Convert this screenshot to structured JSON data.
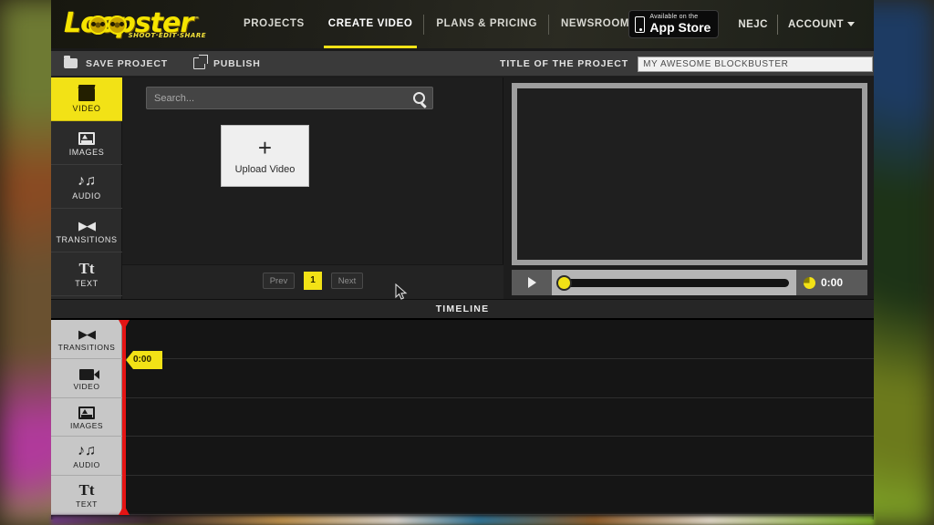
{
  "header": {
    "logo_text": "Loopster",
    "logo_tm": "™",
    "logo_tagline": "SHOOT·EDIT·SHARE",
    "nav": [
      {
        "label": "PROJECTS",
        "active": false
      },
      {
        "label": "CREATE VIDEO",
        "active": true
      },
      {
        "label": "PLANS & PRICING",
        "active": false
      },
      {
        "label": "NEWSROOM",
        "active": false
      }
    ],
    "appstore": {
      "small": "Available on the",
      "big": "App Store"
    },
    "user": "NEJC",
    "account": "ACCOUNT"
  },
  "toolbar": {
    "save_label": "SAVE PROJECT",
    "publish_label": "PUBLISH",
    "title_label": "TITLE OF THE PROJECT",
    "title_value": "MY AWESOME BLOCKBUSTER"
  },
  "rail": {
    "items": [
      {
        "label": "VIDEO",
        "icon": "clapperboard-icon",
        "active": true
      },
      {
        "label": "IMAGES",
        "icon": "image-icon",
        "active": false
      },
      {
        "label": "AUDIO",
        "icon": "music-note-icon",
        "active": false
      },
      {
        "label": "TRANSITIONS",
        "icon": "transition-icon",
        "active": false
      },
      {
        "label": "TEXT",
        "icon": "text-icon",
        "active": false
      }
    ]
  },
  "browser": {
    "search_placeholder": "Search...",
    "search_value": "",
    "upload_plus": "+",
    "upload_label": "Upload Video",
    "pager": {
      "prev": "Prev",
      "page": "1",
      "next": "Next"
    }
  },
  "player": {
    "play_icon": "play-icon",
    "clock_icon": "clock-icon",
    "time": "0:00",
    "progress_percent": 0
  },
  "timeline": {
    "title": "TIMELINE",
    "playhead_time": "0:00",
    "tracks": [
      {
        "label": "TRANSITIONS",
        "icon": "transition-icon"
      },
      {
        "label": "VIDEO",
        "icon": "video-camera-icon"
      },
      {
        "label": "IMAGES",
        "icon": "image-icon"
      },
      {
        "label": "AUDIO",
        "icon": "music-note-icon"
      },
      {
        "label": "TEXT",
        "icon": "text-icon"
      }
    ]
  },
  "colors": {
    "accent_yellow": "#f2e216",
    "playhead_red": "#e51414",
    "app_dark": "#1d1d1d"
  }
}
